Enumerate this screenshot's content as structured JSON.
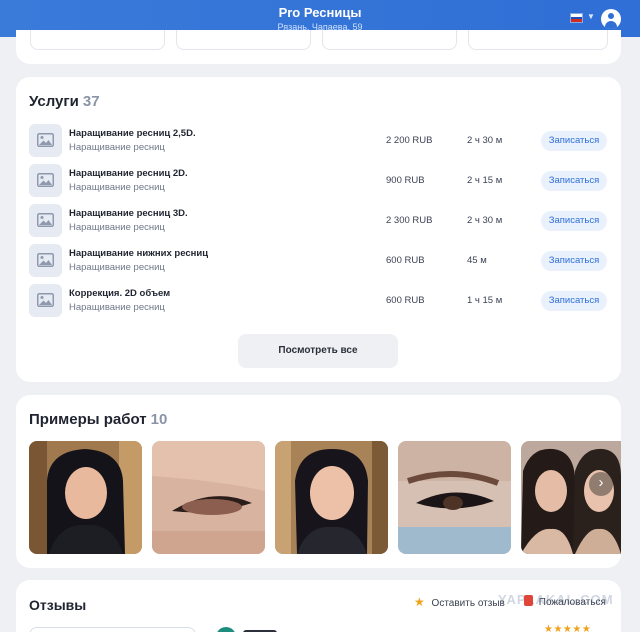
{
  "header": {
    "title": "Pro Ресницы",
    "address": "Рязань, Чапаева, 59",
    "colors": {
      "primary": "#2f6fd6"
    },
    "icons": {
      "language": "russian-flag-icon",
      "account": "user-icon"
    }
  },
  "services": {
    "title": "Услуги",
    "count": "37",
    "book_label": "Записаться",
    "see_all_label": "Посмотреть все",
    "items": [
      {
        "name": "Наращивание ресниц 2,5D.",
        "category": "Наращивание ресниц",
        "price": "2 200 RUB",
        "duration": "2 ч 30 м"
      },
      {
        "name": "Наращивание ресниц 2D.",
        "category": "Наращивание ресниц",
        "price": "900 RUB",
        "duration": "2 ч 15 м"
      },
      {
        "name": "Наращивание ресниц 3D.",
        "category": "Наращивание ресниц",
        "price": "2 300 RUB",
        "duration": "2 ч 30 м"
      },
      {
        "name": "Наращивание нижних ресниц",
        "category": "Наращивание ресниц",
        "price": "600 RUB",
        "duration": "45 м"
      },
      {
        "name": "Коррекция. 2D объем",
        "category": "Наращивание ресниц",
        "price": "600 RUB",
        "duration": "1 ч 15 м"
      }
    ]
  },
  "works": {
    "title": "Примеры работ",
    "count": "10",
    "next_icon": "chevron-right-icon"
  },
  "reviews": {
    "title": "Отзывы",
    "leave_review_label": "Оставить отзыв",
    "complain_label": "Пожаловаться",
    "rating_stars": 5
  },
  "watermark": "YAPLAKAL.COM"
}
